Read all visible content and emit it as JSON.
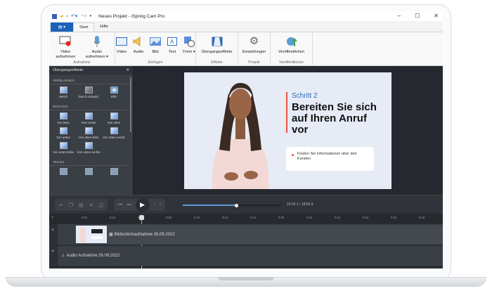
{
  "window": {
    "title": "Neues Projekt - iSpring Cam Pro",
    "minimize": "–",
    "maximize": "☐",
    "close": "✕"
  },
  "tabs": [
    {
      "label": "Start"
    },
    {
      "label": "Hilfe"
    }
  ],
  "file_button": "▤ ▾",
  "ribbon": {
    "groups": [
      {
        "label": "Aufnahme",
        "buttons": [
          {
            "label": "Video aufnehmen",
            "icon": "record-video-icon"
          },
          {
            "label": "Audio aufnehmen ▾",
            "icon": "microphone-icon"
          }
        ]
      },
      {
        "label": "Einfügen",
        "buttons": [
          {
            "label": "Video",
            "icon": "film-icon"
          },
          {
            "label": "Audio",
            "icon": "speaker-icon"
          },
          {
            "label": "Bild",
            "icon": "image-icon"
          },
          {
            "label": "Text",
            "icon": "text-icon"
          },
          {
            "label": "Form ▾",
            "icon": "shape-icon"
          }
        ]
      },
      {
        "label": "Effekte",
        "buttons": [
          {
            "label": "Übergangseffekte",
            "icon": "transition-icon"
          }
        ]
      },
      {
        "label": "Projekt",
        "buttons": [
          {
            "label": "Einstellungen",
            "icon": "gear-icon"
          }
        ]
      },
      {
        "label": "Veröffentlichen",
        "buttons": [
          {
            "label": "Veröffentlichen",
            "icon": "globe-upload-icon"
          }
        ]
      }
    ]
  },
  "panel": {
    "title": "Übergangseffekte",
    "close": "✕",
    "sections": [
      {
        "label": "VERBLASSEN",
        "items": [
          "Weich",
          "Durch schwarz",
          "Blitz"
        ]
      },
      {
        "label": "WISCHEN",
        "items": [
          "Von links",
          "Von rechts",
          "Von oben",
          "Von unten",
          "Von oben links",
          "Von oben rechts",
          "Von unten links",
          "Von unten rechts"
        ]
      },
      {
        "label": "TEILEN",
        "items": [
          "",
          "",
          ""
        ]
      }
    ]
  },
  "slide": {
    "step": "Schritt 2",
    "heading": "Bereiten Sie sich auf Ihren Anruf vor",
    "bullet": "Finden Sie Informationen über den Kunden",
    "accent": "#e8583f",
    "step_color": "#2f6db5"
  },
  "player": {
    "time": "10:15.1 / 18:54.3",
    "progress": 0.54
  },
  "ruler": {
    "ticks": [
      "0:02",
      "0:04",
      "0:06",
      "0:08",
      "0:10",
      "0:12",
      "0:14",
      "0:06",
      "0:10",
      "0:12",
      "0:14",
      "0:16",
      "0:18"
    ]
  },
  "tracks": [
    {
      "label": "Bildschirmaufnahme 26.09.2022"
    },
    {
      "label": "Audio Aufnahme 26.09.2022"
    }
  ]
}
